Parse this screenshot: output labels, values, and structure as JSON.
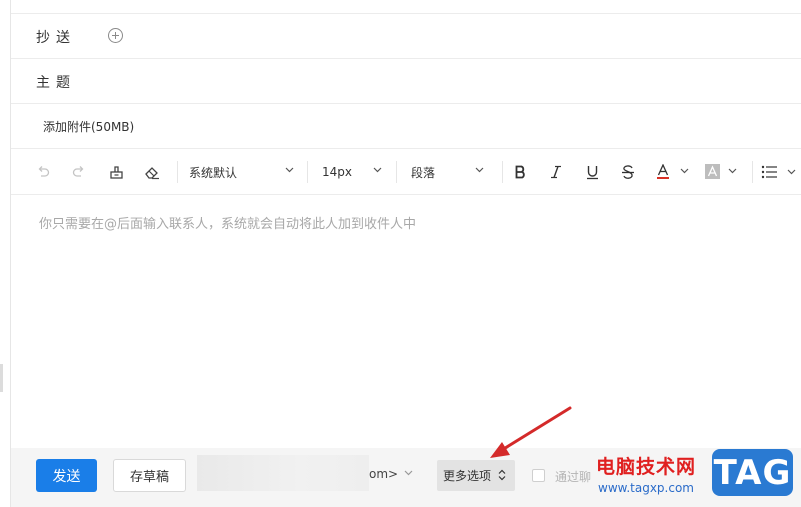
{
  "compose": {
    "cc_label": "抄送",
    "subject_label": "主题",
    "attach_label": "添加附件(50MB)",
    "placeholder": "你只需要在@后面输入联系人，系统就会自动将此人加到收件人中"
  },
  "toolbar": {
    "font_family": "系统默认",
    "font_size": "14px",
    "paragraph": "段落",
    "icons": [
      "undo-icon",
      "redo-icon",
      "format-painter-icon",
      "eraser-icon",
      "bold-icon",
      "italic-icon",
      "underline-icon",
      "strikethrough-icon",
      "font-color-icon",
      "highlight-icon",
      "list-icon"
    ],
    "font_color": "#d93025"
  },
  "footer": {
    "send_label": "发送",
    "draft_label": "存草稿",
    "sender_tail": "om>",
    "more_label": "更多选项",
    "chat_label": "通过聊"
  },
  "watermark": {
    "site_name": "电脑技术网",
    "url": "www.tagxp.com",
    "badge": "TAG"
  },
  "colors": {
    "accent": "#1a7ee8",
    "arrow": "#d42a2a",
    "watermark_red": "#e02020",
    "watermark_blue": "#2a7ad2"
  }
}
